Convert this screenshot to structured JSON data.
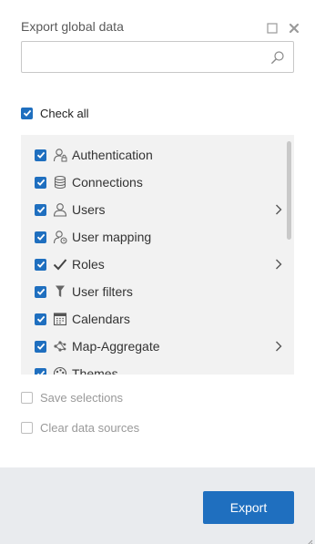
{
  "dialog": {
    "title": "Export global data",
    "maximize_icon": "maximize-icon",
    "close_icon": "close-icon"
  },
  "search": {
    "value": "",
    "placeholder": "",
    "icon": "search-icon"
  },
  "check_all": {
    "label": "Check all",
    "checked": true
  },
  "items": [
    {
      "label": "Authentication",
      "icon": "user-lock-icon",
      "checked": true,
      "has_submenu": false
    },
    {
      "label": "Connections",
      "icon": "database-icon",
      "checked": true,
      "has_submenu": false
    },
    {
      "label": "Users",
      "icon": "user-icon",
      "checked": true,
      "has_submenu": true
    },
    {
      "label": "User mapping",
      "icon": "user-mapping-icon",
      "checked": true,
      "has_submenu": false
    },
    {
      "label": "Roles",
      "icon": "checkmark-icon",
      "checked": true,
      "has_submenu": true
    },
    {
      "label": "User filters",
      "icon": "funnel-icon",
      "checked": true,
      "has_submenu": false
    },
    {
      "label": "Calendars",
      "icon": "calendar-icon",
      "checked": true,
      "has_submenu": false
    },
    {
      "label": "Map-Aggregate",
      "icon": "hierarchy-icon",
      "checked": true,
      "has_submenu": true
    },
    {
      "label": "Themes",
      "icon": "palette-icon",
      "checked": true,
      "has_submenu": false
    }
  ],
  "options": {
    "save_selections": {
      "label": "Save selections",
      "checked": false
    },
    "clear_data_sources": {
      "label": "Clear data sources",
      "checked": false
    }
  },
  "footer": {
    "export_label": "Export"
  },
  "colors": {
    "accent": "#1f6fbf",
    "footer_bg": "#e9ebee",
    "list_bg": "#f2f2f2"
  }
}
